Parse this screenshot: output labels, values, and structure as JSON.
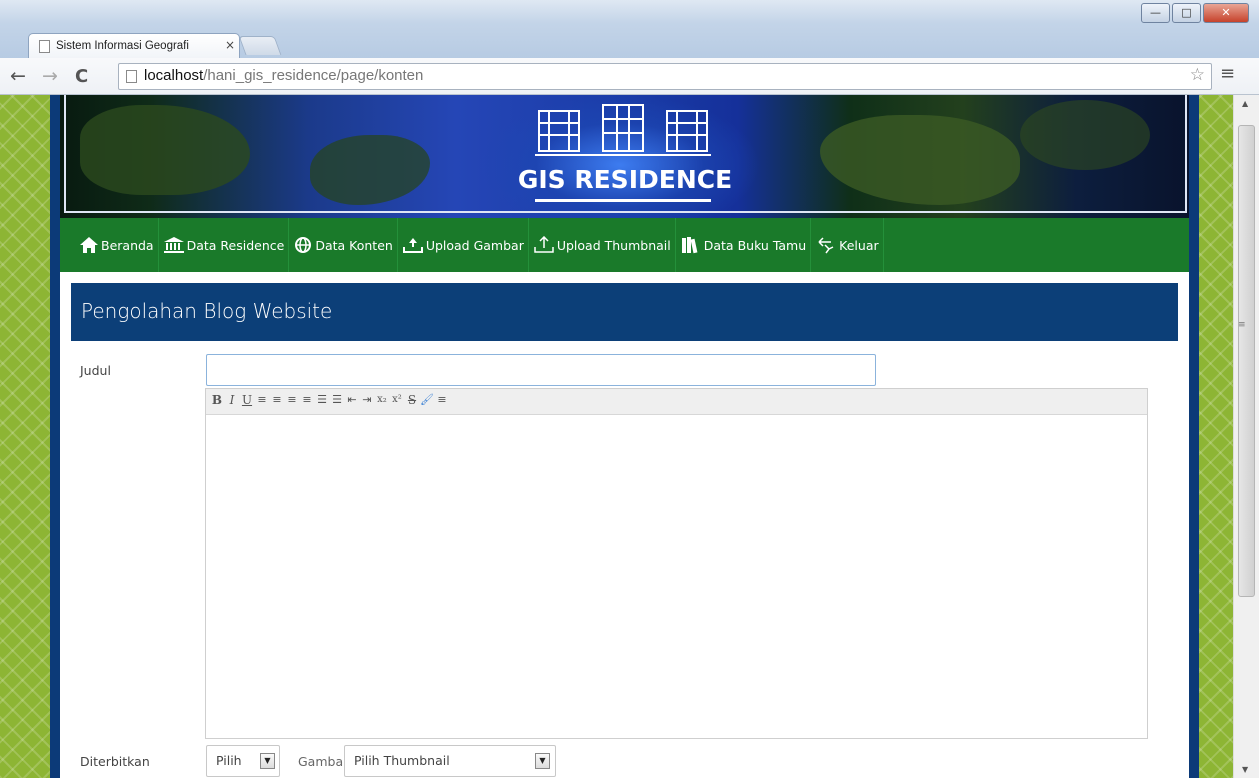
{
  "browser": {
    "tab_title": "Sistem Informasi Geografi",
    "tab_close": "×",
    "url_host": "localhost",
    "url_path": "/hani_gis_residence/page/konten",
    "back": "←",
    "forward": "→",
    "reload": "C",
    "star": "☆",
    "menu": "≡",
    "min": "—",
    "max": "□",
    "close": "✕"
  },
  "banner": {
    "title": "GIS RESIDENCE"
  },
  "nav": {
    "items": [
      {
        "label": "Beranda",
        "icon": "home-icon"
      },
      {
        "label": "Data Residence",
        "icon": "bank-icon"
      },
      {
        "label": "Data Konten",
        "icon": "globe-icon"
      },
      {
        "label": "Upload Gambar",
        "icon": "upload-cloud-icon"
      },
      {
        "label": "Upload Thumbnail",
        "icon": "upload-icon"
      },
      {
        "label": "Data Buku Tamu",
        "icon": "books-icon"
      },
      {
        "label": "Keluar",
        "icon": "exit-icon"
      }
    ]
  },
  "panel": {
    "title": "Pengolahan Blog Website"
  },
  "form": {
    "judul_label": "Judul",
    "judul_value": "",
    "editor_buttons": [
      "B",
      "I",
      "U",
      "≡",
      "≡",
      "≡",
      "≡",
      "☰",
      "☰",
      "⇤",
      "⇥",
      "x₂",
      "x²",
      "S",
      "🖌",
      "≡"
    ],
    "diterbitkan_label": "Diterbitkan",
    "diterbitkan_value": "Pilih",
    "gambar_label": "Gambar",
    "gambar_value": "Pilih Thumbnail",
    "dropdown_arrow": "▼"
  },
  "colors": {
    "green_bg": "#8db534",
    "nav_green": "#1a7a2a",
    "panel_blue": "#0c3f78"
  }
}
